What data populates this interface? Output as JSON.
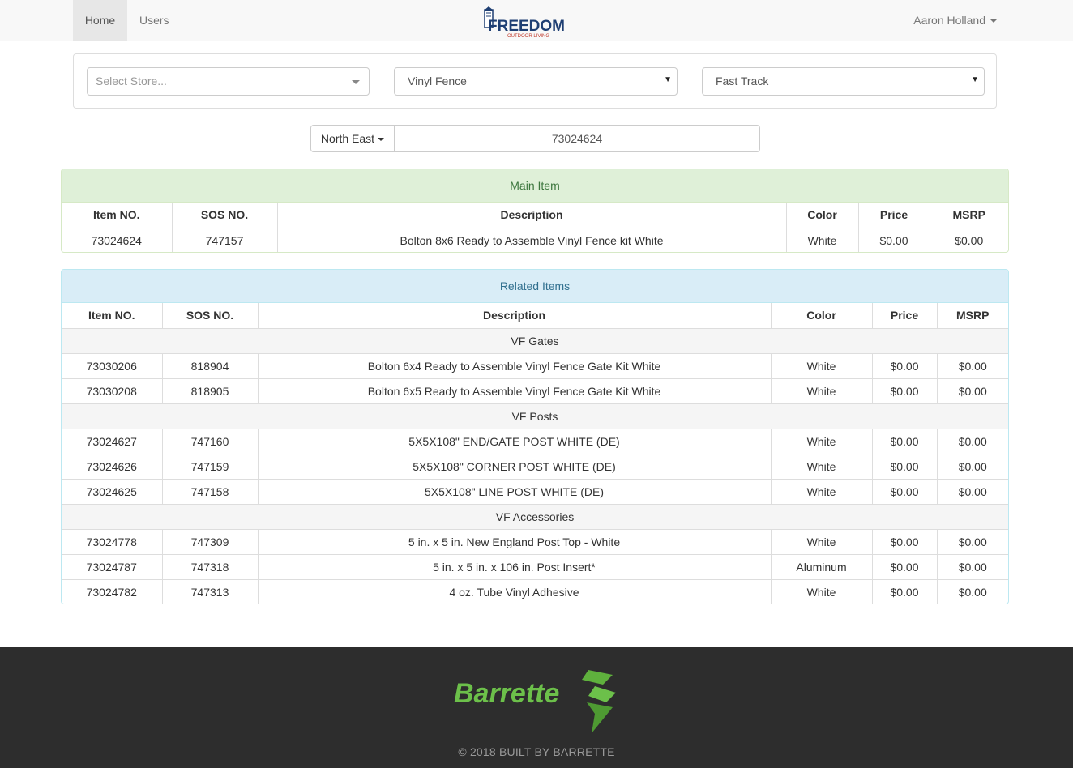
{
  "nav": {
    "home": "Home",
    "users": "Users",
    "brand_name": "FREEDOM",
    "brand_tagline": "OUTDOOR LIVING",
    "user_name": "Aaron Holland"
  },
  "filters": {
    "store_placeholder": "Select Store...",
    "product_line": "Vinyl Fence",
    "program": "Fast Track"
  },
  "search": {
    "region": "North East",
    "value": "73024624"
  },
  "main_item": {
    "heading": "Main Item",
    "headers": [
      "Item NO.",
      "SOS NO.",
      "Description",
      "Color",
      "Price",
      "MSRP"
    ],
    "row": {
      "item": "73024624",
      "sos": "747157",
      "desc": "Bolton 8x6 Ready to Assemble Vinyl Fence kit White",
      "color": "White",
      "price": "$0.00",
      "msrp": "$0.00"
    }
  },
  "related": {
    "heading": "Related Items",
    "headers": [
      "Item NO.",
      "SOS NO.",
      "Description",
      "Color",
      "Price",
      "MSRP"
    ],
    "groups": [
      {
        "name": "VF Gates",
        "rows": [
          {
            "item": "73030206",
            "sos": "818904",
            "desc": "Bolton 6x4 Ready to Assemble Vinyl Fence Gate Kit White",
            "color": "White",
            "price": "$0.00",
            "msrp": "$0.00"
          },
          {
            "item": "73030208",
            "sos": "818905",
            "desc": "Bolton 6x5 Ready to Assemble Vinyl Fence Gate Kit White",
            "color": "White",
            "price": "$0.00",
            "msrp": "$0.00"
          }
        ]
      },
      {
        "name": "VF Posts",
        "rows": [
          {
            "item": "73024627",
            "sos": "747160",
            "desc": "5X5X108\" END/GATE POST WHITE (DE)",
            "color": "White",
            "price": "$0.00",
            "msrp": "$0.00"
          },
          {
            "item": "73024626",
            "sos": "747159",
            "desc": "5X5X108\" CORNER POST WHITE (DE)",
            "color": "White",
            "price": "$0.00",
            "msrp": "$0.00"
          },
          {
            "item": "73024625",
            "sos": "747158",
            "desc": "5X5X108\" LINE POST WHITE (DE)",
            "color": "White",
            "price": "$0.00",
            "msrp": "$0.00"
          }
        ]
      },
      {
        "name": "VF Accessories",
        "rows": [
          {
            "item": "73024778",
            "sos": "747309",
            "desc": "5 in. x 5 in. New England Post Top - White",
            "color": "White",
            "price": "$0.00",
            "msrp": "$0.00"
          },
          {
            "item": "73024787",
            "sos": "747318",
            "desc": "5 in. x 5 in. x 106 in. Post Insert*",
            "color": "Aluminum",
            "price": "$0.00",
            "msrp": "$0.00"
          },
          {
            "item": "73024782",
            "sos": "747313",
            "desc": "4 oz. Tube Vinyl Adhesive",
            "color": "White",
            "price": "$0.00",
            "msrp": "$0.00"
          }
        ]
      }
    ]
  },
  "footer": {
    "logo_text": "Barrette",
    "copyright": "© 2018 BUILT BY BARRETTE"
  },
  "colors": {
    "brand_blue": "#1f3f73",
    "brand_red": "#c0392b",
    "barrette_green": "#6cc04a",
    "success_bg": "#dff0d8",
    "info_bg": "#d9edf7",
    "footer_bg": "#2d2d2d"
  }
}
